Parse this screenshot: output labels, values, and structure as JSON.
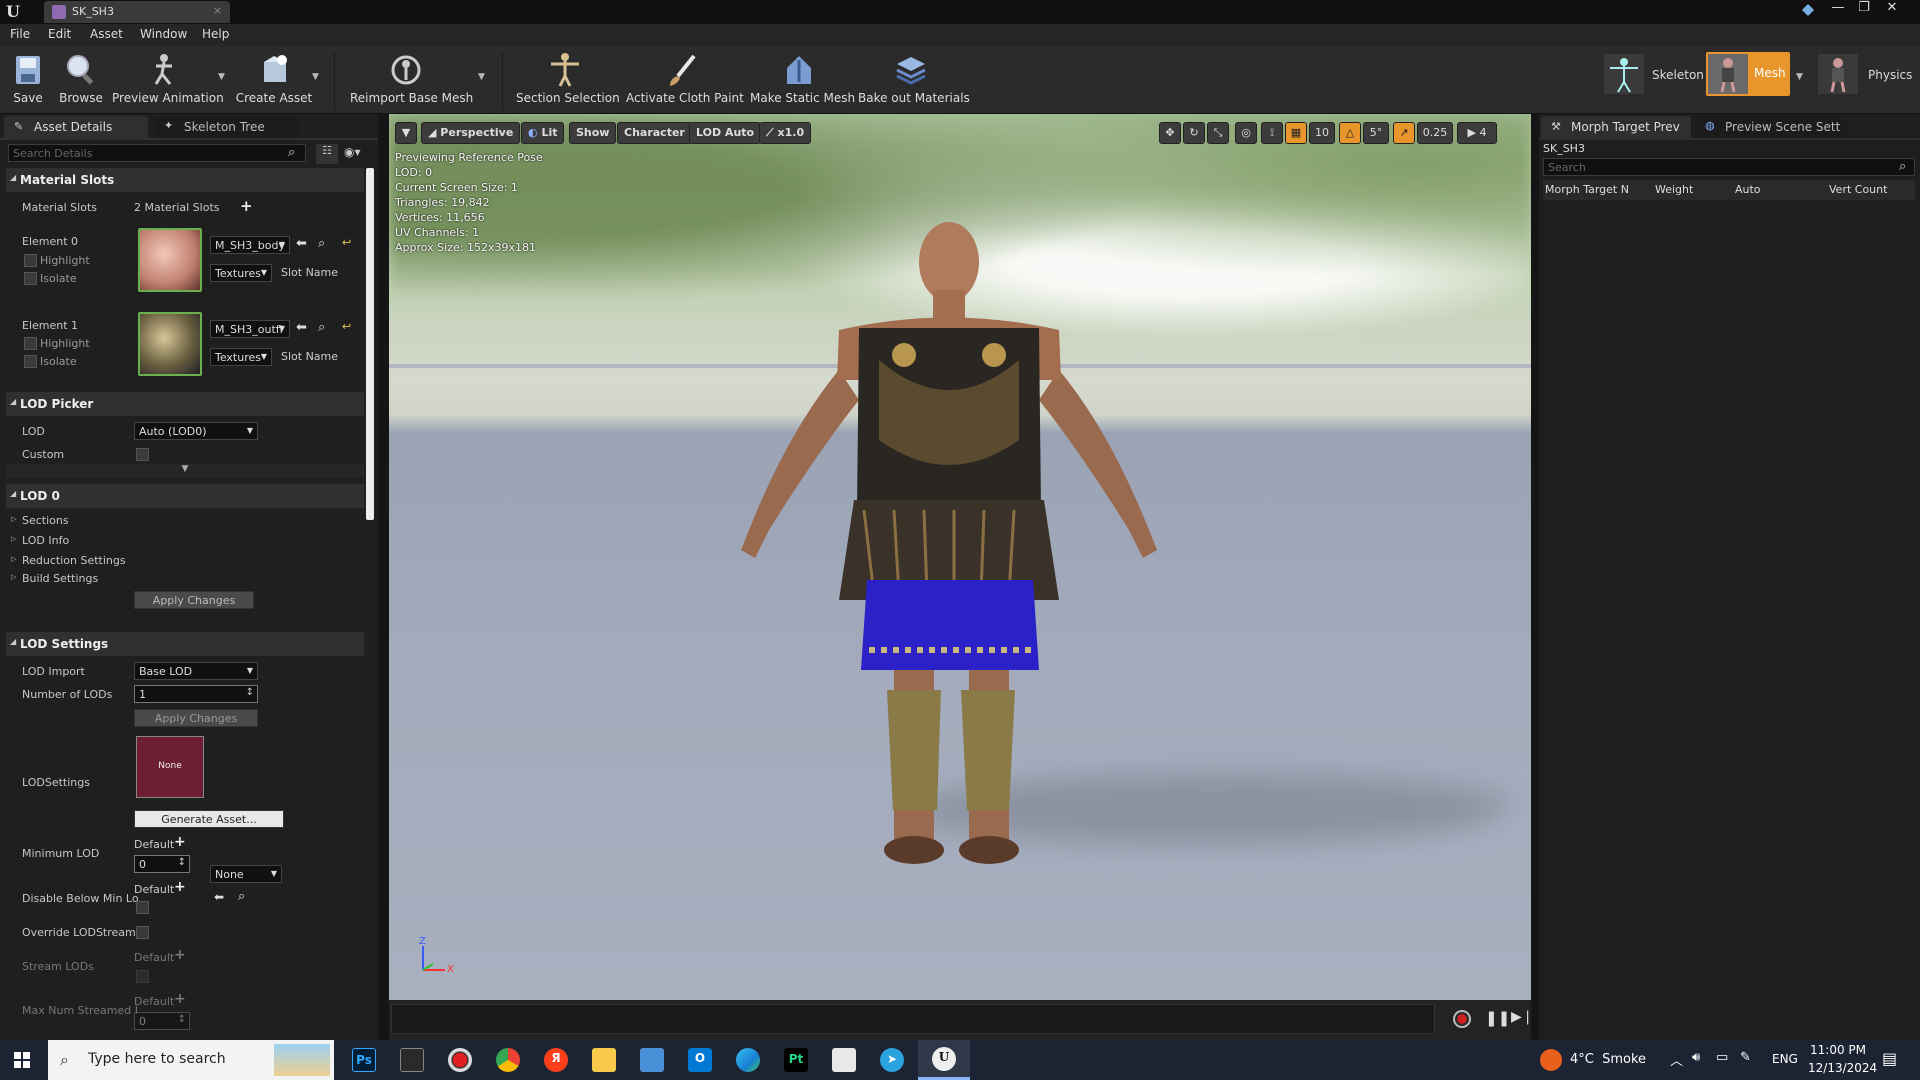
{
  "window": {
    "tab_title": "SK_SH3",
    "minimize_glyph": "—",
    "restore_glyph": "❐",
    "close_glyph": "✕",
    "logo_glyph": "U",
    "tab_close_glyph": "×"
  },
  "menu": [
    "File",
    "Edit",
    "Asset",
    "Window",
    "Help"
  ],
  "toolbar": {
    "save": "Save",
    "browse": "Browse",
    "preview_animation": "Preview Animation",
    "create_asset": "Create Asset",
    "reimport": "Reimport Base Mesh",
    "section_selection": "Section Selection",
    "activate_cloth": "Activate Cloth Paint",
    "make_static": "Make Static Mesh",
    "bake_materials": "Bake out Materials",
    "mode_skeleton": "Skeleton",
    "mode_mesh": "Mesh",
    "mode_physics": "Physics",
    "dropdown_glyph": "▼"
  },
  "left_panel": {
    "tab_asset_details": "Asset Details",
    "tab_skeleton_tree": "Skeleton Tree",
    "search_placeholder": "Search Details",
    "material_slots": {
      "header": "Material Slots",
      "label": "Material Slots",
      "count": "2 Material Slots",
      "elements": [
        {
          "name": "Element 0",
          "material": "M_SH3_body",
          "highlight": "Highlight",
          "isolate": "Isolate",
          "textures": "Textures",
          "slot_name": "Slot Name"
        },
        {
          "name": "Element 1",
          "material": "M_SH3_outfi",
          "highlight": "Highlight",
          "isolate": "Isolate",
          "textures": "Textures",
          "slot_name": "Slot Name"
        }
      ]
    },
    "lod_picker": {
      "header": "LOD Picker",
      "lod_label": "LOD",
      "lod_value": "Auto (LOD0)",
      "custom_label": "Custom"
    },
    "lod0": {
      "header": "LOD 0",
      "items": [
        "Sections",
        "LOD Info",
        "Reduction Settings",
        "Build Settings"
      ],
      "apply": "Apply Changes"
    },
    "lod_settings": {
      "header": "LOD Settings",
      "lod_import_label": "LOD Import",
      "lod_import_value": "Base LOD",
      "num_lods_label": "Number of LODs",
      "num_lods_value": "1",
      "apply": "Apply Changes",
      "lodsettings_label": "LODSettings",
      "asset_thumb": "None",
      "asset_value": "None",
      "generate": "Generate Asset...",
      "min_lod_label": "Minimum LOD",
      "default_label": "Default",
      "min_lod_value": "0",
      "disable_below_label": "Disable Below Min Lo",
      "override_label": "Override LODStreami",
      "stream_lods_label": "Stream LODs",
      "max_num_label": "Max Num Streamed I",
      "max_num_value": "0"
    }
  },
  "viewport": {
    "buttons": {
      "perspective": "Perspective",
      "lit": "Lit",
      "show": "Show",
      "character": "Character",
      "lod_auto": "LOD Auto",
      "speed": "x1.0"
    },
    "snap": {
      "grid": "10",
      "rot": "5°",
      "scale": "0.25",
      "cam": "4"
    },
    "info": [
      "Previewing Reference Pose",
      "LOD: 0",
      "Current Screen Size: 1",
      "Triangles: 19,842",
      "Vertices: 11,656",
      "UV Channels: 1",
      "Approx Size: 152x39x181"
    ],
    "axis_z": "Z",
    "axis_x": "X"
  },
  "right_panel": {
    "tab_morph": "Morph Target Prev",
    "tab_scene": "Preview Scene Sett",
    "asset_name": "SK_SH3",
    "search_placeholder": "Search",
    "columns": [
      "Morph Target N",
      "Weight",
      "Auto",
      "Vert Count"
    ]
  },
  "taskbar": {
    "search_placeholder": "Type here to search",
    "weather": "4°C  Smoke",
    "lang": "ENG",
    "time": "11:00 PM",
    "date": "12/13/2024"
  },
  "colors": {
    "accent_mesh": "#e8962c",
    "thumb_border": "#6ab04c",
    "lod_thumb": "#6e1e33"
  }
}
